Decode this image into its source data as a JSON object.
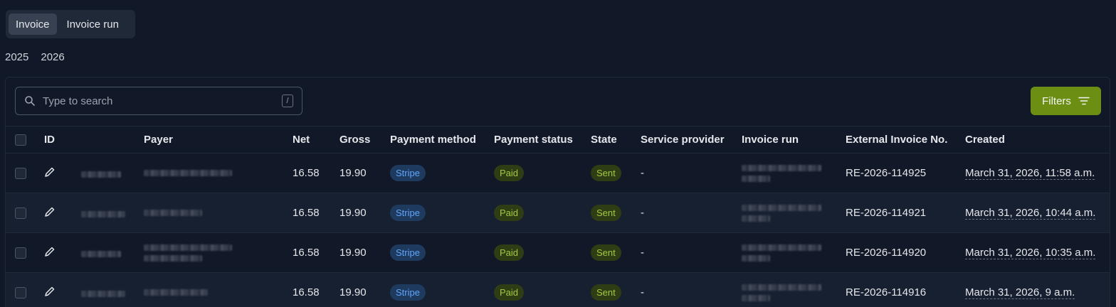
{
  "tabs": [
    {
      "label": "Invoice",
      "active": true
    },
    {
      "label": "Invoice run",
      "active": false
    }
  ],
  "years": [
    "2025",
    "2026"
  ],
  "search": {
    "placeholder": "Type to search",
    "shortcut": "/"
  },
  "filters": {
    "label": "Filters"
  },
  "table": {
    "headers": {
      "id": "ID",
      "payer": "Payer",
      "net": "Net",
      "gross": "Gross",
      "payment_method": "Payment method",
      "payment_status": "Payment status",
      "state": "State",
      "service_provider": "Service provider",
      "invoice_run": "Invoice run",
      "external_no": "External Invoice No.",
      "created": "Created"
    },
    "rows": [
      {
        "net": "16.58",
        "gross": "19.90",
        "payment_method": "Stripe",
        "payment_status": "Paid",
        "state": "Sent",
        "service_provider": "-",
        "external_no": "RE-2026-114925",
        "created": "March 31, 2026, 11:58 a.m."
      },
      {
        "net": "16.58",
        "gross": "19.90",
        "payment_method": "Stripe",
        "payment_status": "Paid",
        "state": "Sent",
        "service_provider": "-",
        "external_no": "RE-2026-114921",
        "created": "March 31, 2026, 10:44 a.m."
      },
      {
        "net": "16.58",
        "gross": "19.90",
        "payment_method": "Stripe",
        "payment_status": "Paid",
        "state": "Sent",
        "service_provider": "-",
        "external_no": "RE-2026-114920",
        "created": "March 31, 2026, 10:35 a.m."
      },
      {
        "net": "16.58",
        "gross": "19.90",
        "payment_method": "Stripe",
        "payment_status": "Paid",
        "state": "Sent",
        "service_provider": "-",
        "external_no": "RE-2026-114916",
        "created": "March 31, 2026, 9 a.m."
      }
    ]
  },
  "colors": {
    "background": "#111827",
    "accent": "#6b8e13",
    "badge_blue": "#60a5fa",
    "badge_green": "#a3c940"
  },
  "icons": [
    "search-icon",
    "filter-icon",
    "pencil-icon"
  ]
}
